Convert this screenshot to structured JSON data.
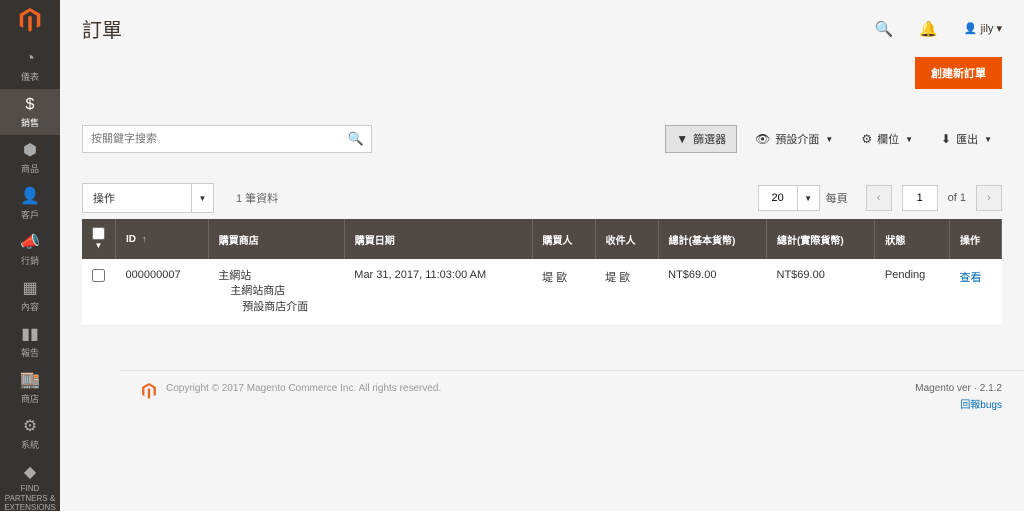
{
  "page": {
    "title": "訂單"
  },
  "user": {
    "name": "jily"
  },
  "sidebar": {
    "items": [
      {
        "label": "儀表"
      },
      {
        "label": "銷售"
      },
      {
        "label": "商品"
      },
      {
        "label": "客戶"
      },
      {
        "label": "行銷"
      },
      {
        "label": "內容"
      },
      {
        "label": "報告"
      },
      {
        "label": "商店"
      },
      {
        "label": "系統"
      },
      {
        "label": "FIND PARTNERS & EXTENSIONS"
      }
    ]
  },
  "buttons": {
    "create": "創建新訂單"
  },
  "search": {
    "placeholder": "按關鍵字搜索"
  },
  "toolbar": {
    "filters": "篩選器",
    "default_view": "預設介面",
    "columns": "欄位",
    "export": "匯出"
  },
  "grid_ctrl": {
    "actions": "操作",
    "records_found": "1 筆資料",
    "page_size": "20",
    "per_page": "每頁",
    "page": "1",
    "of": "of 1"
  },
  "columns": {
    "id": "ID",
    "store": "購買商店",
    "date": "購買日期",
    "buyer": "購買人",
    "recipient": "收件人",
    "total_base": "總計(基本貨幣)",
    "total_paid": "總計(實際貨幣)",
    "status": "狀態",
    "action": "操作"
  },
  "rows": [
    {
      "id": "000000007",
      "store_l1": "主網站",
      "store_l2": "主網站商店",
      "store_l3": "預設商店介面",
      "date": "Mar 31, 2017, 11:03:00 AM",
      "buyer": "堤 歐",
      "recipient": "堤 歐",
      "total_base": "NT$69.00",
      "total_paid": "NT$69.00",
      "status": "Pending",
      "action": "查看"
    }
  ],
  "footer": {
    "copyright": "Copyright © 2017 Magento Commerce Inc. All rights reserved.",
    "version": "Magento ver · 2.1.2",
    "bugs": "回報bugs"
  }
}
